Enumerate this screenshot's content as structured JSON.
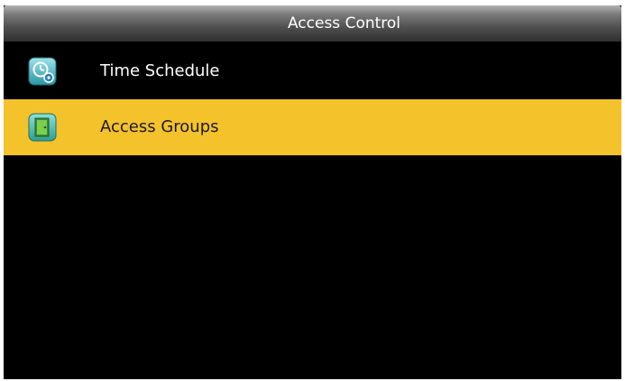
{
  "header": {
    "title": "Access Control"
  },
  "menu": {
    "items": [
      {
        "label": "Time Schedule",
        "icon": "clock-schedule-icon",
        "selected": false
      },
      {
        "label": "Access Groups",
        "icon": "door-group-icon",
        "selected": true
      }
    ]
  },
  "colors": {
    "background": "#000000",
    "selected_row": "#f4c22b",
    "title_text": "#ffffff"
  }
}
